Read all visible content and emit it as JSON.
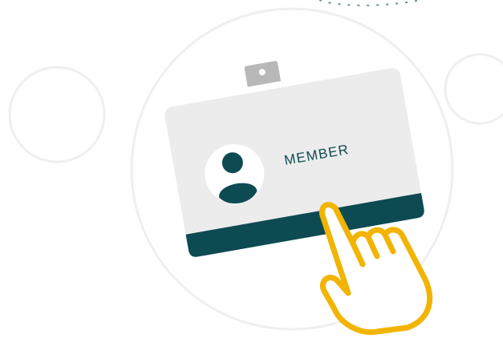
{
  "badge": {
    "label": "MEMBER",
    "avatar_icon": "person-icon",
    "clip_icon": "badge-clip-icon"
  },
  "pointer": {
    "icon": "pointing-hand-icon"
  },
  "colors": {
    "card": "#ececec",
    "card_stripe": "#0e4a52",
    "avatar": "#0e4a52",
    "avatar_bg": "#ffffff",
    "clip": "#b8b8b8",
    "text": "#0e4a52",
    "hand_outline": "#f2b400",
    "hand_fill": "#ffffff",
    "decor_circles": "#efefef"
  }
}
